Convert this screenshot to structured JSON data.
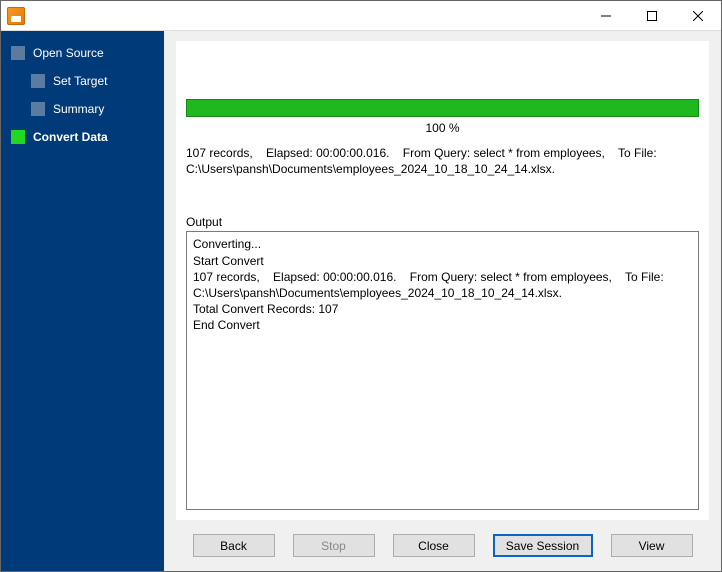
{
  "titlebar": {
    "title": ""
  },
  "sidebar": {
    "items": [
      {
        "label": "Open Source",
        "active": false,
        "indent": 0
      },
      {
        "label": "Set Target",
        "active": false,
        "indent": 1
      },
      {
        "label": "Summary",
        "active": false,
        "indent": 1
      },
      {
        "label": "Convert Data",
        "active": true,
        "indent": 0
      }
    ]
  },
  "progress": {
    "percent_label": "100 %",
    "value": 100
  },
  "summary_text": "107 records,    Elapsed: 00:00:00.016.    From Query: select * from employees,    To File: C:\\Users\\pansh\\Documents\\employees_2024_10_18_10_24_14.xlsx.",
  "output": {
    "label": "Output",
    "lines": [
      "Converting...",
      "Start Convert",
      "107 records,    Elapsed: 00:00:00.016.    From Query: select * from employees,    To File: C:\\Users\\pansh\\Documents\\employees_2024_10_18_10_24_14.xlsx.",
      "Total Convert Records: 107",
      "End Convert"
    ]
  },
  "buttons": {
    "back": "Back",
    "stop": "Stop",
    "close": "Close",
    "save_session": "Save Session",
    "view": "View"
  }
}
